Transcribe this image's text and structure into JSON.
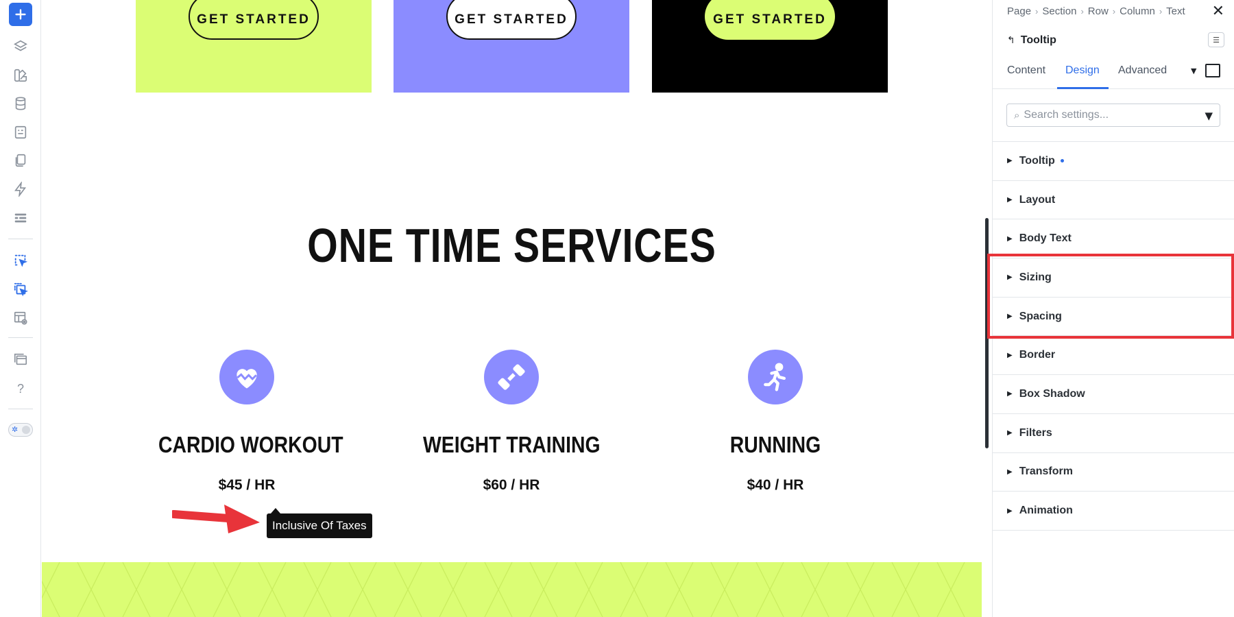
{
  "toolbar": {
    "icons": [
      "add-icon",
      "layers-icon",
      "swatches-icon",
      "database-icon",
      "form-icon",
      "pages-icon",
      "lightning-icon",
      "list-icon",
      "select-element-icon",
      "select-multiple-icon",
      "layout-preview-icon",
      "stack-icon",
      "help-icon",
      "dark-mode-toggle"
    ],
    "help_label": "?"
  },
  "canvas": {
    "cards": [
      {
        "button_label": "GET STARTED",
        "bg": "#dbfd74"
      },
      {
        "button_label": "GET STARTED",
        "bg": "#8b8cff"
      },
      {
        "button_label": "GET STARTED",
        "bg": "#000000"
      }
    ],
    "section_title": "ONE TIME SERVICES",
    "services": [
      {
        "name": "CARDIO WORKOUT",
        "price": "$45 / HR",
        "icon": "heart-icon"
      },
      {
        "name": "WEIGHT TRAINING",
        "price": "$60 / HR",
        "icon": "dumbbell-icon"
      },
      {
        "name": "RUNNING",
        "price": "$40 / HR",
        "icon": "running-icon"
      }
    ],
    "tooltip": "Inclusive Of Taxes",
    "accent_lime": "#dbfd74",
    "accent_purple": "#8b8cff"
  },
  "panel": {
    "breadcrumb": [
      "Page",
      "Section",
      "Row",
      "Column",
      "Text"
    ],
    "element_title": "Tooltip",
    "tabs": {
      "content": "Content",
      "design": "Design",
      "advanced": "Advanced"
    },
    "active_tab": "Design",
    "search": {
      "placeholder": "Search settings..."
    },
    "sections": [
      "Tooltip",
      "Layout",
      "Body Text",
      "Sizing",
      "Spacing",
      "Border",
      "Box Shadow",
      "Filters",
      "Transform",
      "Animation"
    ],
    "highlighted_sections": [
      "Sizing",
      "Spacing"
    ],
    "accent": "#2f6ee8",
    "highlight_color": "#e8343a"
  }
}
